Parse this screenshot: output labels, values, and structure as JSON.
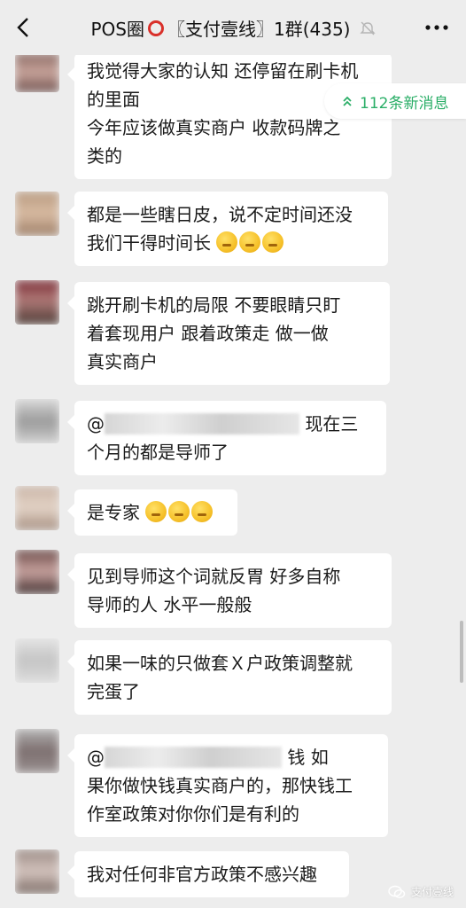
{
  "header": {
    "title_prefix": "POS圈",
    "title_suffix": "〖支付壹线〗1群(435)"
  },
  "new_messages": {
    "label": "112条新消息"
  },
  "messages": [
    {
      "lines": [
        "我觉得大家的认知 还停留在刷卡机",
        "的里面",
        "今年应该做真实商户  收款码牌之",
        "类的"
      ]
    },
    {
      "lines": [
        "都是一些瞎日皮，说不定时间还没",
        "我们干得时间长"
      ]
    },
    {
      "lines": [
        "跳开刷卡机的局限  不要眼睛只盯",
        "着套现用户   跟着政策走  做一做",
        "真实商户"
      ]
    },
    {
      "lines": [
        "@",
        "现在三",
        "个月的都是导师了"
      ]
    },
    {
      "lines": [
        "是专家"
      ]
    },
    {
      "lines": [
        "见到导师这个词就反胃  好多自称",
        "导师的人  水平一般般"
      ]
    },
    {
      "lines": [
        "如果一味的只做套Ｘ户政策调整就",
        "完蛋了"
      ]
    },
    {
      "lines": [
        "@",
        "钱  如",
        "果你做快钱真实商户的，那快钱工",
        "作室政策对你你们是有利的"
      ]
    },
    {
      "lines": [
        "我对任何非官方政策不感兴趣"
      ]
    }
  ],
  "watermark": {
    "label": "支付壹线"
  },
  "colors": {
    "background": "#ededed",
    "bubble": "#ffffff",
    "accent_green": "#2aae67",
    "ring_red": "#d9302a"
  },
  "icons": [
    "back-arrow-icon",
    "mute-icon",
    "more-icon",
    "double-chevron-up-icon",
    "emoji-icon",
    "wechat-icon"
  ]
}
